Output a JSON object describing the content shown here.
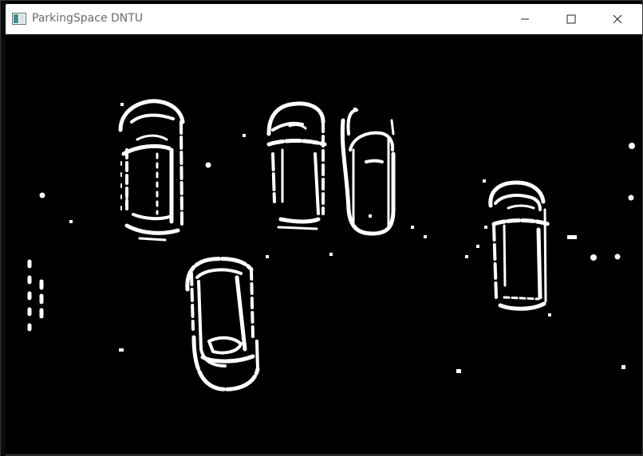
{
  "window": {
    "title": "ParkingSpace DNTU",
    "icon": "app-window-icon",
    "controls": {
      "minimize": "minimize-icon",
      "maximize": "maximize-icon",
      "close": "close-icon"
    }
  },
  "canvas": {
    "background": "#000000",
    "foreground": "#ffffff",
    "content": "binary-edge-image"
  }
}
